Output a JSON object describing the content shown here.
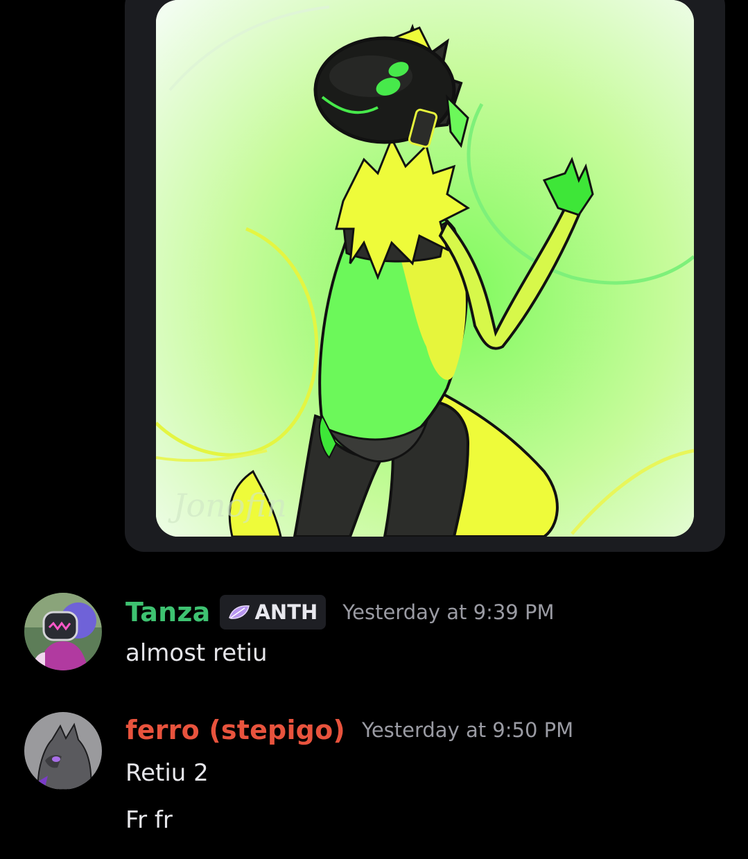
{
  "embed": {
    "image_alt": "Illustration of a green and yellow protogen character",
    "watermark": "Jonofin"
  },
  "messages": [
    {
      "username": "Tanza",
      "username_color": "#3ec271",
      "role_tag": "ANTH",
      "role_icon": "leaf-icon",
      "timestamp": "Yesterday at 9:39 PM",
      "lines": [
        "almost retiu"
      ]
    },
    {
      "username": "ferro (stepigo)",
      "username_color": "#e8533d",
      "timestamp": "Yesterday at 9:50 PM",
      "lines": [
        "Retiu 2",
        "Fr fr"
      ]
    }
  ]
}
